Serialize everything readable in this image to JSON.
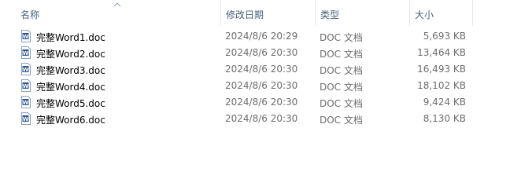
{
  "columns": {
    "name": "名称",
    "modified": "修改日期",
    "type": "类型",
    "size": "大小"
  },
  "files": [
    {
      "name": "完整Word1.doc",
      "modified": "2024/8/6 20:29",
      "type": "DOC 文档",
      "size": "5,693 KB",
      "icon": "word-doc-icon"
    },
    {
      "name": "完整Word2.doc",
      "modified": "2024/8/6 20:30",
      "type": "DOC 文档",
      "size": "13,464 KB",
      "icon": "word-doc-icon"
    },
    {
      "name": "完整Word3.doc",
      "modified": "2024/8/6 20:30",
      "type": "DOC 文档",
      "size": "16,493 KB",
      "icon": "word-doc-icon"
    },
    {
      "name": "完整Word4.doc",
      "modified": "2024/8/6 20:30",
      "type": "DOC 文档",
      "size": "18,102 KB",
      "icon": "word-doc-icon"
    },
    {
      "name": "完整Word5.doc",
      "modified": "2024/8/6 20:30",
      "type": "DOC 文档",
      "size": "9,424 KB",
      "icon": "word-doc-icon"
    },
    {
      "name": "完整Word6.doc",
      "modified": "2024/8/6 20:30",
      "type": "DOC 文档",
      "size": "8,130 KB",
      "icon": "word-doc-icon"
    }
  ],
  "colors": {
    "header_text": "#4c607a",
    "name_text": "#000000",
    "meta_text": "#6d6d6d",
    "icon_blue": "#2b5797"
  }
}
